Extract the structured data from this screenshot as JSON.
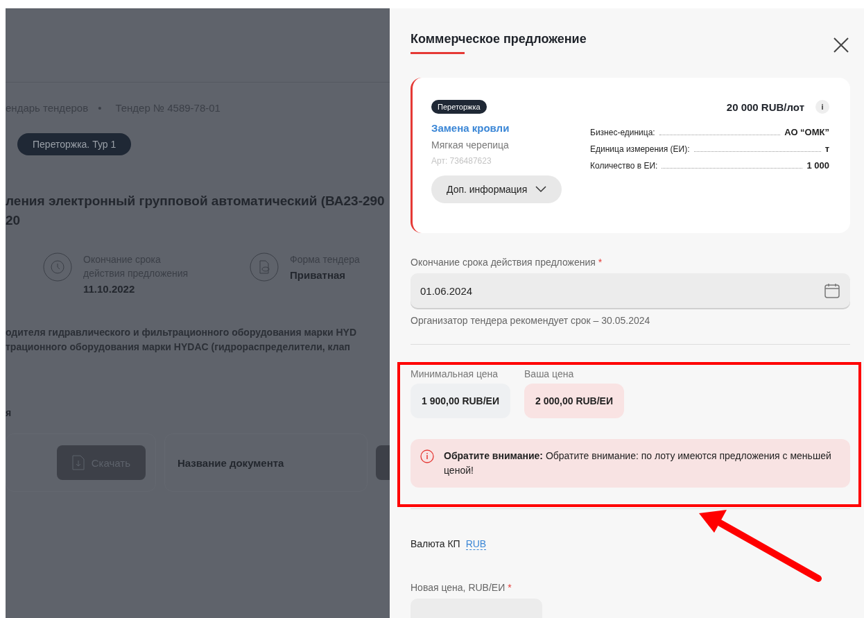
{
  "background_page": {
    "breadcrumbs": [
      "ендарь тендеров",
      "Тендер № 4589-78-01"
    ],
    "breadcrumb_separator": "•",
    "stage_badge": "Переторжка. Тур 1",
    "title_lines": [
      "ления электронный групповой автоматический (ВА23-290",
      "20"
    ],
    "info_items": [
      {
        "kind": "clock",
        "label": "Окончание срока",
        "label_2": "действия предложения",
        "value": "11.10.2022"
      },
      {
        "kind": "form",
        "label": "Форма тендера",
        "value": "Приватная"
      }
    ],
    "description_lines": [
      "одителя гидравлического и фильтрационного оборудования марки HYD",
      "трационного оборудования марки HYDAC (гидрораспределители, клап"
    ],
    "section_fragment": "я",
    "download_button": "Скачать",
    "document_name": "Название документа"
  },
  "panel": {
    "title": "Коммерческое предложение",
    "lot_card": {
      "badge": "Переторжка",
      "price": "20 000 RUB/лот",
      "info_glyph": "i",
      "name": "Замена кровли",
      "subtitle": "Мягкая черепица",
      "article": "Арт: 736487623",
      "more_button": "Доп. информация",
      "details": [
        {
          "label": "Бизнес-единица:",
          "value": "АО “ОМК”"
        },
        {
          "label": "Единица измерения (ЕИ):",
          "value": "т"
        },
        {
          "label": "Количество в ЕИ:",
          "value": "1 000"
        }
      ]
    },
    "expiry_field": {
      "label": "Окончание срока действия предложения",
      "required_mark": "*",
      "value": "01.06.2024",
      "hint": "Организатор тендера рекомендует срок – 30.05.2024"
    },
    "prices": [
      {
        "kind": "neutral",
        "label": "Минимальная цена",
        "value": "1 900,00 RUB/ЕИ"
      },
      {
        "kind": "warning",
        "label": "Ваша цена",
        "value": "2 000,00 RUB/ЕИ"
      }
    ],
    "alert": "**Обратите внимание:** Обратите внимание: по лоту имеются предложения с меньшей ценой!",
    "currency": {
      "label": "Валюта КП",
      "value": "RUB"
    },
    "new_price_field": {
      "label": "Новая цена, RUB/ЕИ",
      "required_mark": "*"
    }
  }
}
